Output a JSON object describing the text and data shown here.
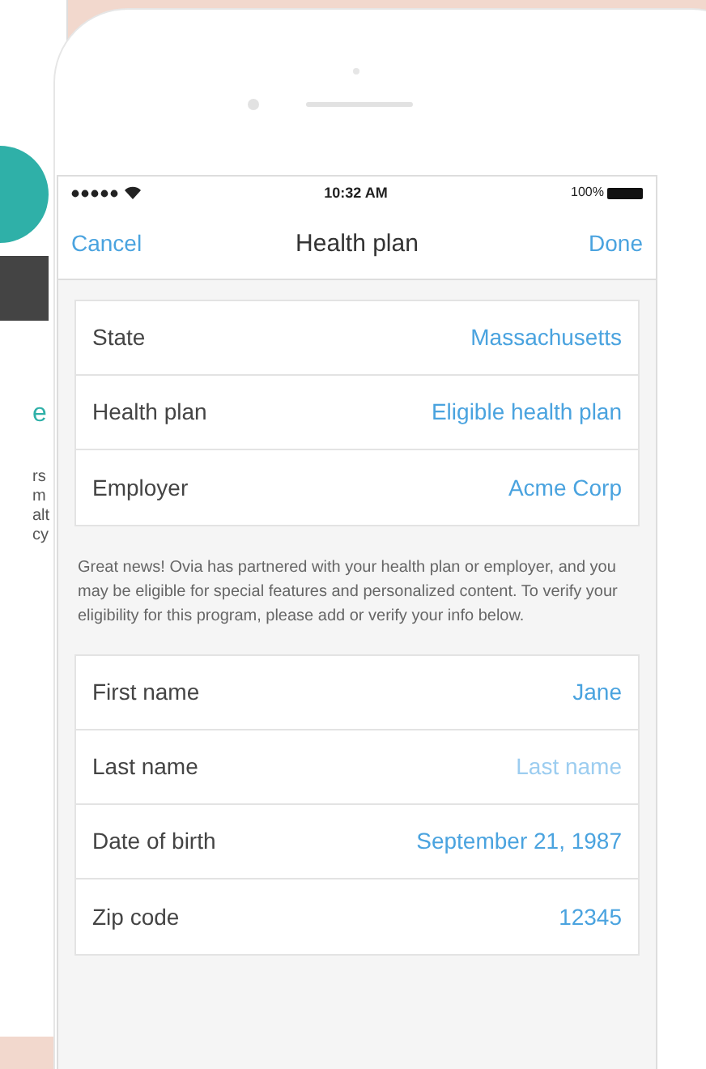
{
  "background_app": {
    "heading_fragment": "e",
    "text_fragments": [
      "rs",
      "m",
      "alt",
      "cy"
    ]
  },
  "status_bar": {
    "time": "10:32 AM",
    "battery": "100%"
  },
  "nav": {
    "cancel": "Cancel",
    "title": "Health plan",
    "done": "Done"
  },
  "plan_rows": [
    {
      "label": "State",
      "value": "Massachusetts"
    },
    {
      "label": "Health plan",
      "value": "Eligible health plan"
    },
    {
      "label": "Employer",
      "value": "Acme Corp"
    }
  ],
  "notice": "Great news! Ovia has partnered with your health plan or employer, and you may be eligible for special features and personalized content. To verify your eligibility for this program, please add or verify your info below.",
  "personal_rows": [
    {
      "label": "First name",
      "value": "Jane"
    },
    {
      "label": "Last name",
      "placeholder": "Last name"
    },
    {
      "label": "Date of birth",
      "value": "September 21, 1987"
    },
    {
      "label": "Zip code",
      "value": "12345"
    }
  ]
}
